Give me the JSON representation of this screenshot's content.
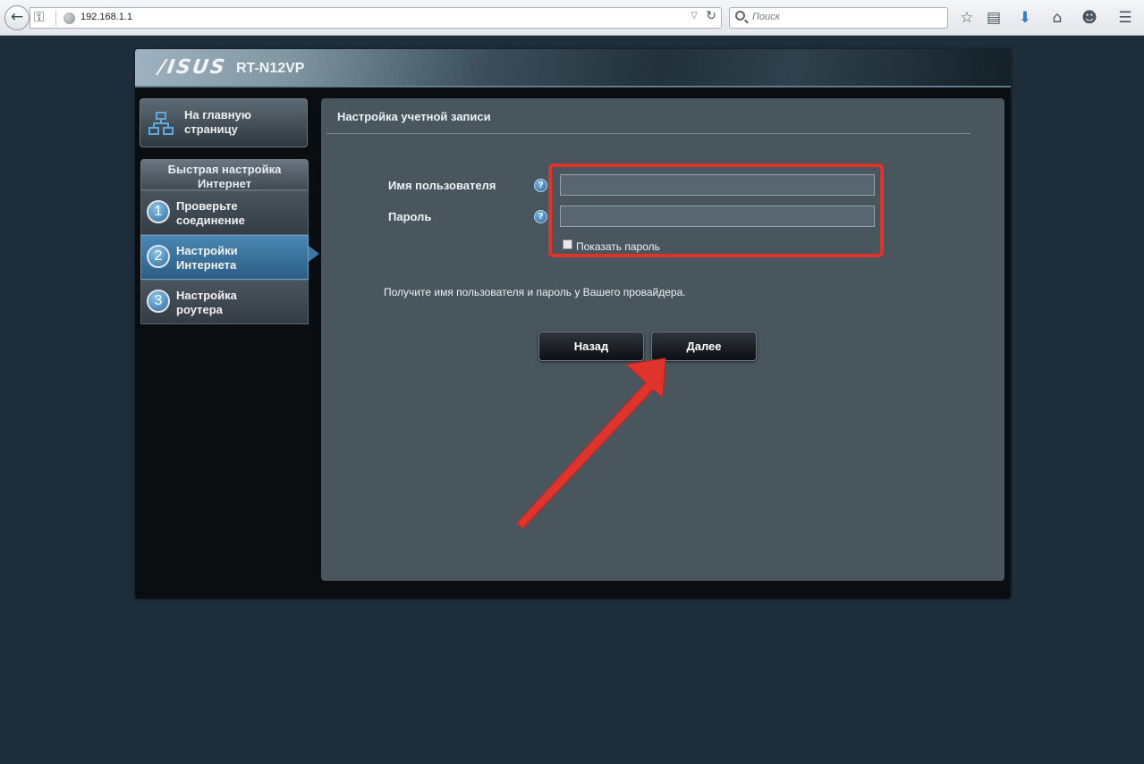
{
  "browser": {
    "url": "192.168.1.1",
    "search_placeholder": "Поиск",
    "icons": [
      "back-icon",
      "key-icon",
      "globe-icon",
      "dropdown-icon",
      "reload-icon",
      "search-icon",
      "bookmark-star-icon",
      "reading-list-icon",
      "download-icon",
      "home-icon",
      "chat-icon",
      "menu-icon"
    ]
  },
  "router": {
    "brand": "/ISUS",
    "model": "RT-N12VP"
  },
  "sidebar": {
    "home_line1": "На главную",
    "home_line2": "страницу",
    "qis_title_line1": "Быстрая настройка",
    "qis_title_line2": "Интернет",
    "steps": [
      {
        "num": "1",
        "line1": "Проверьте",
        "line2": "соединение",
        "active": false
      },
      {
        "num": "2",
        "line1": "Настройки",
        "line2": "Интернета",
        "active": true
      },
      {
        "num": "3",
        "line1": "Настройка",
        "line2": "роутера",
        "active": false
      }
    ]
  },
  "panel": {
    "title": "Настройка учетной записи",
    "username_label": "Имя пользователя",
    "password_label": "Пароль",
    "username_value": "",
    "password_value": "",
    "help_glyph": "?",
    "show_password_label": "Показать пароль",
    "show_password_checked": false,
    "info": "Получите имя пользователя и пароль у Вашего провайдера.",
    "back_label": "Назад",
    "next_label": "Далее"
  },
  "colors": {
    "highlight": "#e0332c",
    "arrow": "#e0332c",
    "active_step": "#3b77a4",
    "page_bg": "#1e2d3a"
  }
}
